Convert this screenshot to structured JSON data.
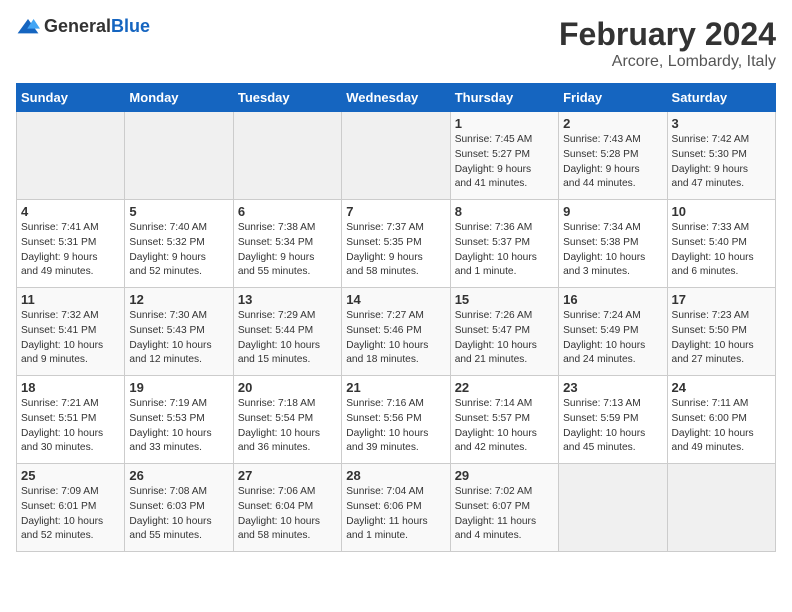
{
  "logo": {
    "general": "General",
    "blue": "Blue"
  },
  "title": "February 2024",
  "subtitle": "Arcore, Lombardy, Italy",
  "days_header": [
    "Sunday",
    "Monday",
    "Tuesday",
    "Wednesday",
    "Thursday",
    "Friday",
    "Saturday"
  ],
  "weeks": [
    [
      {
        "day": "",
        "info": ""
      },
      {
        "day": "",
        "info": ""
      },
      {
        "day": "",
        "info": ""
      },
      {
        "day": "",
        "info": ""
      },
      {
        "day": "1",
        "info": "Sunrise: 7:45 AM\nSunset: 5:27 PM\nDaylight: 9 hours\nand 41 minutes."
      },
      {
        "day": "2",
        "info": "Sunrise: 7:43 AM\nSunset: 5:28 PM\nDaylight: 9 hours\nand 44 minutes."
      },
      {
        "day": "3",
        "info": "Sunrise: 7:42 AM\nSunset: 5:30 PM\nDaylight: 9 hours\nand 47 minutes."
      }
    ],
    [
      {
        "day": "4",
        "info": "Sunrise: 7:41 AM\nSunset: 5:31 PM\nDaylight: 9 hours\nand 49 minutes."
      },
      {
        "day": "5",
        "info": "Sunrise: 7:40 AM\nSunset: 5:32 PM\nDaylight: 9 hours\nand 52 minutes."
      },
      {
        "day": "6",
        "info": "Sunrise: 7:38 AM\nSunset: 5:34 PM\nDaylight: 9 hours\nand 55 minutes."
      },
      {
        "day": "7",
        "info": "Sunrise: 7:37 AM\nSunset: 5:35 PM\nDaylight: 9 hours\nand 58 minutes."
      },
      {
        "day": "8",
        "info": "Sunrise: 7:36 AM\nSunset: 5:37 PM\nDaylight: 10 hours\nand 1 minute."
      },
      {
        "day": "9",
        "info": "Sunrise: 7:34 AM\nSunset: 5:38 PM\nDaylight: 10 hours\nand 3 minutes."
      },
      {
        "day": "10",
        "info": "Sunrise: 7:33 AM\nSunset: 5:40 PM\nDaylight: 10 hours\nand 6 minutes."
      }
    ],
    [
      {
        "day": "11",
        "info": "Sunrise: 7:32 AM\nSunset: 5:41 PM\nDaylight: 10 hours\nand 9 minutes."
      },
      {
        "day": "12",
        "info": "Sunrise: 7:30 AM\nSunset: 5:43 PM\nDaylight: 10 hours\nand 12 minutes."
      },
      {
        "day": "13",
        "info": "Sunrise: 7:29 AM\nSunset: 5:44 PM\nDaylight: 10 hours\nand 15 minutes."
      },
      {
        "day": "14",
        "info": "Sunrise: 7:27 AM\nSunset: 5:46 PM\nDaylight: 10 hours\nand 18 minutes."
      },
      {
        "day": "15",
        "info": "Sunrise: 7:26 AM\nSunset: 5:47 PM\nDaylight: 10 hours\nand 21 minutes."
      },
      {
        "day": "16",
        "info": "Sunrise: 7:24 AM\nSunset: 5:49 PM\nDaylight: 10 hours\nand 24 minutes."
      },
      {
        "day": "17",
        "info": "Sunrise: 7:23 AM\nSunset: 5:50 PM\nDaylight: 10 hours\nand 27 minutes."
      }
    ],
    [
      {
        "day": "18",
        "info": "Sunrise: 7:21 AM\nSunset: 5:51 PM\nDaylight: 10 hours\nand 30 minutes."
      },
      {
        "day": "19",
        "info": "Sunrise: 7:19 AM\nSunset: 5:53 PM\nDaylight: 10 hours\nand 33 minutes."
      },
      {
        "day": "20",
        "info": "Sunrise: 7:18 AM\nSunset: 5:54 PM\nDaylight: 10 hours\nand 36 minutes."
      },
      {
        "day": "21",
        "info": "Sunrise: 7:16 AM\nSunset: 5:56 PM\nDaylight: 10 hours\nand 39 minutes."
      },
      {
        "day": "22",
        "info": "Sunrise: 7:14 AM\nSunset: 5:57 PM\nDaylight: 10 hours\nand 42 minutes."
      },
      {
        "day": "23",
        "info": "Sunrise: 7:13 AM\nSunset: 5:59 PM\nDaylight: 10 hours\nand 45 minutes."
      },
      {
        "day": "24",
        "info": "Sunrise: 7:11 AM\nSunset: 6:00 PM\nDaylight: 10 hours\nand 49 minutes."
      }
    ],
    [
      {
        "day": "25",
        "info": "Sunrise: 7:09 AM\nSunset: 6:01 PM\nDaylight: 10 hours\nand 52 minutes."
      },
      {
        "day": "26",
        "info": "Sunrise: 7:08 AM\nSunset: 6:03 PM\nDaylight: 10 hours\nand 55 minutes."
      },
      {
        "day": "27",
        "info": "Sunrise: 7:06 AM\nSunset: 6:04 PM\nDaylight: 10 hours\nand 58 minutes."
      },
      {
        "day": "28",
        "info": "Sunrise: 7:04 AM\nSunset: 6:06 PM\nDaylight: 11 hours\nand 1 minute."
      },
      {
        "day": "29",
        "info": "Sunrise: 7:02 AM\nSunset: 6:07 PM\nDaylight: 11 hours\nand 4 minutes."
      },
      {
        "day": "",
        "info": ""
      },
      {
        "day": "",
        "info": ""
      }
    ]
  ]
}
